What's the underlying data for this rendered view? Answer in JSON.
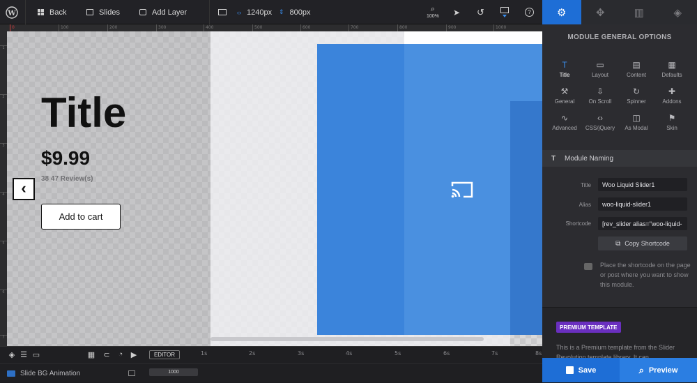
{
  "toolbar": {
    "back_label": "Back",
    "slides_label": "Slides",
    "add_layer_label": "Add Layer",
    "width_value": "1240px",
    "height_value": "800px",
    "zoom_label": "100%"
  },
  "ruler": {
    "h_ticks": [
      "0",
      "100",
      "200",
      "300",
      "400",
      "500",
      "600",
      "700",
      "800",
      "900",
      "1000"
    ],
    "v_ticks": [
      "1",
      "2",
      "3",
      "4",
      "5",
      "6",
      "7"
    ]
  },
  "slide": {
    "title": "Title",
    "price": "$9.99",
    "reviews": "38 47 Review(s)",
    "add_to_cart": "Add to cart",
    "prev_arrow": "‹"
  },
  "timeline": {
    "editor_label": "EDITOR",
    "marks": [
      "1s",
      "2s",
      "3s",
      "4s",
      "5s",
      "6s",
      "7s",
      "8s"
    ],
    "bg_animation_label": "Slide BG Animation",
    "duration": "1000"
  },
  "panel": {
    "title": "MODULE GENERAL OPTIONS",
    "options": [
      {
        "label": "Title",
        "glyph": "T",
        "active": true
      },
      {
        "label": "Layout",
        "glyph": "▭",
        "active": false
      },
      {
        "label": "Content",
        "glyph": "▤",
        "active": false
      },
      {
        "label": "Defaults",
        "glyph": "▦",
        "active": false
      },
      {
        "label": "General",
        "glyph": "⚒",
        "active": false
      },
      {
        "label": "On Scroll",
        "glyph": "⇩",
        "active": false
      },
      {
        "label": "Spinner",
        "glyph": "↻",
        "active": false
      },
      {
        "label": "Addons",
        "glyph": "✚",
        "active": false
      },
      {
        "label": "Advanced",
        "glyph": "∿",
        "active": false
      },
      {
        "label": "CSS/jQuery",
        "glyph": "‹›",
        "active": false
      },
      {
        "label": "As Modal",
        "glyph": "◫",
        "active": false
      },
      {
        "label": "Skin",
        "glyph": "⚑",
        "active": false
      }
    ],
    "naming_title": "Module Naming",
    "title_label": "Title",
    "title_value": "Woo Liquid Slider1",
    "alias_label": "Alias",
    "alias_value": "woo-liquid-slider1",
    "shortcode_label": "Shortcode",
    "shortcode_value": "[rev_slider alias=\"woo-liquid-",
    "copy_label": "Copy Shortcode",
    "hint": "Place the shortcode on the page or post where you want to show this module.",
    "premium_badge": "PREMIUM TEMPLATE",
    "premium_text": "This is a Premium template from the Slider Revolution template library. It can"
  },
  "actions": {
    "save_label": "Save",
    "preview_label": "Preview"
  },
  "colors": {
    "accent": "#1e6ed6",
    "blue_layer": "#3b84db",
    "premium": "#6a2fbf"
  }
}
